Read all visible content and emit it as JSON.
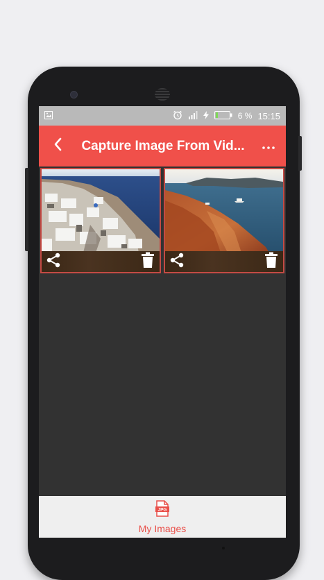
{
  "status_bar": {
    "battery_percent": "6 %",
    "time": "15:15",
    "icons": [
      "image-icon",
      "alarm-icon",
      "signal-icon",
      "charging-icon",
      "battery-icon"
    ]
  },
  "app_bar": {
    "title": "Capture Image From Vid...",
    "back_icon": "back-arrow-icon",
    "menu_icon": "more-horizontal-icon",
    "color": "#f0504a"
  },
  "gallery": {
    "items": [
      {
        "image": "santorini-village-photo",
        "actions": [
          "share-icon",
          "delete-icon"
        ]
      },
      {
        "image": "santorini-cliff-sea-photo",
        "actions": [
          "share-icon",
          "delete-icon"
        ]
      }
    ]
  },
  "bottom_nav": {
    "label": "My Images",
    "icon": "jpg-file-icon",
    "accent": "#e94f49"
  }
}
